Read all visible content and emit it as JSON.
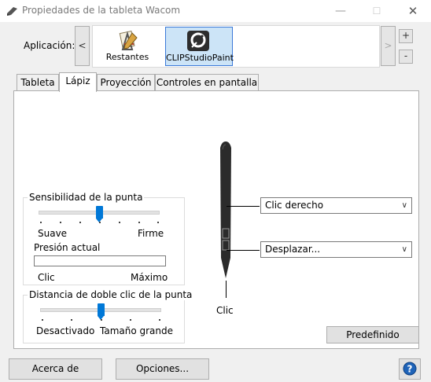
{
  "window": {
    "title": "Propiedades de la tableta Wacom",
    "minimize": "—",
    "maximize": "☐",
    "close": "✕"
  },
  "app_bar": {
    "label": "Aplicación:",
    "scroll_left": "<",
    "scroll_right": ">",
    "add": "+",
    "remove": "-",
    "apps": [
      {
        "name": "Restantes",
        "selected": false
      },
      {
        "name": "CLIPStudioPaint",
        "selected": true
      }
    ]
  },
  "tabs": [
    {
      "label": "Tableta",
      "active": false
    },
    {
      "label": "Lápiz",
      "active": true
    },
    {
      "label": "Proyección",
      "active": false
    },
    {
      "label": "Controles en pantalla",
      "active": false
    }
  ],
  "tip_feel": {
    "title": "Sensibilidad de la punta",
    "min_label": "Suave",
    "max_label": "Firme",
    "level": 0.5,
    "pressure_label": "Presión actual",
    "click_label": "Clic",
    "maximum_label": "Máximo"
  },
  "double_click": {
    "title": "Distancia de doble clic de la punta",
    "min_label": "Desactivado",
    "max_label": "Tamaño grande",
    "level": 0.5
  },
  "pen": {
    "upper_button": "Clic derecho",
    "lower_button": "Desplazar...",
    "tip_label": "Clic"
  },
  "buttons": {
    "default": "Predefinido",
    "about": "Acerca de",
    "options": "Opciones...",
    "help": "?"
  },
  "colors": {
    "accent": "#0078d7",
    "selection_bg": "#cce4f7"
  }
}
